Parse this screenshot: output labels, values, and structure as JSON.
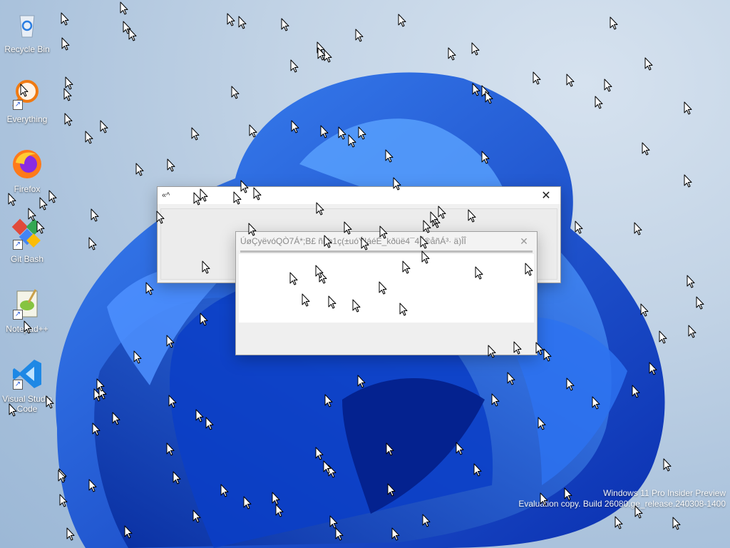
{
  "desktop": {
    "icons": [
      {
        "label": "Recycle Bin",
        "icon": "recycle-bin-icon",
        "shortcut": false
      },
      {
        "label": "Everything",
        "icon": "everything-search-icon",
        "shortcut": true
      },
      {
        "label": "Firefox",
        "icon": "firefox-icon",
        "shortcut": false
      },
      {
        "label": "Git Bash",
        "icon": "git-bash-icon",
        "shortcut": true
      },
      {
        "label": "Notepad++",
        "icon": "notepad-plus-plus-icon",
        "shortcut": true
      },
      {
        "label": "Visual Studio Code",
        "icon": "vscode-icon",
        "shortcut": true
      }
    ]
  },
  "window_back": {
    "title": "«^",
    "close_glyph": "✕"
  },
  "window_front": {
    "title": "ÚøÇyëvóQÒ7Á*;B£ ñhh1ç(±uóÝIáéÉ_kðüë4¯4ÍÌ®åñÁ³· ä)ÎÎ",
    "close_glyph": "✕",
    "progress": 1.0
  },
  "watermark": {
    "line1": "Windows 11 Pro Insider Preview",
    "line2": "Evaluation copy. Build 26080.ge_release.240308-1400"
  },
  "colors": {
    "wallpaper_blue": "#1a4fd6",
    "wallpaper_light": "#3c7bf0",
    "background": "#b6cbe2"
  }
}
